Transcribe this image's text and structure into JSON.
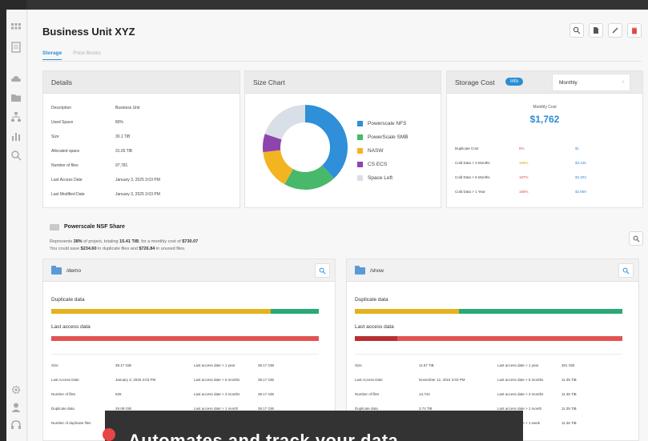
{
  "page": {
    "title": "Business Unit XYZ",
    "tabs": [
      {
        "label": "Storage",
        "active": true
      },
      {
        "label": "Price Books",
        "active": false
      }
    ]
  },
  "toolbar": [
    "search-icon",
    "document-icon",
    "edit-icon",
    "delete-icon"
  ],
  "sidebar": [
    "grid-icon",
    "document-icon",
    "cloud-icon",
    "folder-icon",
    "org-chart-icon",
    "bar-chart-icon",
    "search-icon",
    "settings-icon",
    "user-icon",
    "headset-icon"
  ],
  "details": {
    "title": "Details",
    "rows": [
      {
        "label": "Description",
        "value": "Business Unit"
      },
      {
        "label": "Used Space",
        "value": "80%"
      },
      {
        "label": "Size",
        "value": "30.1 TiB"
      },
      {
        "label": "Allocated space",
        "value": "31.65 TiB"
      },
      {
        "label": "Number of files",
        "value": "97,781"
      },
      {
        "label": "Last Access Date",
        "value": "January 3, 2025 3:03 PM"
      },
      {
        "label": "Last Modified Date",
        "value": "January 3, 2025 3:03 PM"
      }
    ]
  },
  "size_chart": {
    "title": "Size Chart",
    "slices": [
      {
        "name": "Powerscale NFS",
        "percent": 38,
        "color": "#2f8fd8"
      },
      {
        "name": "PowerScale SMB",
        "percent": 20,
        "color": "#48b86a"
      },
      {
        "name": "NASW",
        "percent": 15,
        "color": "#f2b521"
      },
      {
        "name": "CS ECS",
        "percent": 7,
        "color": "#8e44ad"
      },
      {
        "name": "Space Left",
        "percent": 20,
        "color": "#d9dfe6"
      }
    ]
  },
  "storage_cost": {
    "title": "Storage Cost",
    "badge": "Info",
    "period": "Monthly",
    "caption": "Monthly Cost",
    "amount": "$1,762",
    "rows": [
      {
        "label": "Duplicate Cost",
        "percent": "8%",
        "amount": "$1"
      },
      {
        "label": "Cold Data > 3 Months",
        "percent": "166%",
        "amount": "$3,346"
      },
      {
        "label": "Cold Data > 6 Months",
        "percent": "187%",
        "amount": "$3,303"
      },
      {
        "label": "Cold Data > 1 Year",
        "percent": "180%",
        "amount": "$3,959"
      }
    ]
  },
  "share": {
    "title": "Powerscale NSF Share",
    "line1_pre": "Represents ",
    "line1_pct": "38%",
    "line1_mid": " of project, totaling ",
    "line1_size": "15.41 TiB",
    "line1_mid2": ", for a monthly cost of ",
    "line1_cost": "$730.07",
    "line2_pre": "You could save ",
    "line2_a": "$234.60",
    "line2_mid": " in duplicate files and ",
    "line2_b": "$726.84",
    "line2_end": " in unused files."
  },
  "folders": [
    {
      "path": "/demo",
      "duplicate_label": "Duplicate data",
      "duplicate_fraction": 0.82,
      "access_label": "Last access data",
      "access_fraction": 0.0,
      "rows": [
        {
          "k1": "Size",
          "v1": "38.17 GiB",
          "k2": "Last access date > 1 year",
          "v2": "38.17 GiB"
        },
        {
          "k1": "Last Access Date",
          "v1": "January 3, 2025 3:03 PM",
          "k2": "Last access date > 6 months",
          "v2": "38.17 GiB"
        },
        {
          "k1": "Number of files",
          "v1": "528",
          "k2": "Last access date > 3 months",
          "v2": "38.17 GiB"
        },
        {
          "k1": "Duplicate data",
          "v1": "28.08 GiB",
          "k2": "Last access date > 1 month",
          "v2": "38.17 GiB"
        },
        {
          "k1": "Number of duplicate files",
          "v1": "",
          "k2": "",
          "v2": ""
        }
      ]
    },
    {
      "path": "/show",
      "duplicate_label": "Duplicate data",
      "duplicate_fraction": 0.39,
      "access_label": "Last access data",
      "access_fraction": 0.16,
      "rows": [
        {
          "k1": "Size",
          "v1": "11.57 TiB",
          "k2": "Last access date > 1 year",
          "v2": "301 GiB"
        },
        {
          "k1": "Last Access Date",
          "v1": "November 12, 2024 3:03 PM",
          "k2": "Last access date > 6 months",
          "v2": "11.35 TiB"
        },
        {
          "k1": "Number of files",
          "v1": "13,744",
          "k2": "Last access date > 3 months",
          "v2": "11.35 TiB"
        },
        {
          "k1": "Duplicate data",
          "v1": "3.74 TiB",
          "k2": "Last access date > 1 month",
          "v2": "11.35 TiB"
        },
        {
          "k1": "",
          "v1": "",
          "k2": "Last access date > 1 week",
          "v2": "11.35 TiB"
        }
      ]
    }
  ],
  "colors": {
    "accent": "#2b8ed4",
    "yellow": "#e4b21c",
    "green": "#2aa876",
    "red": "#e25252",
    "dark_red": "#b72f2f"
  },
  "overlay": {
    "text": "Automates and track your data"
  }
}
